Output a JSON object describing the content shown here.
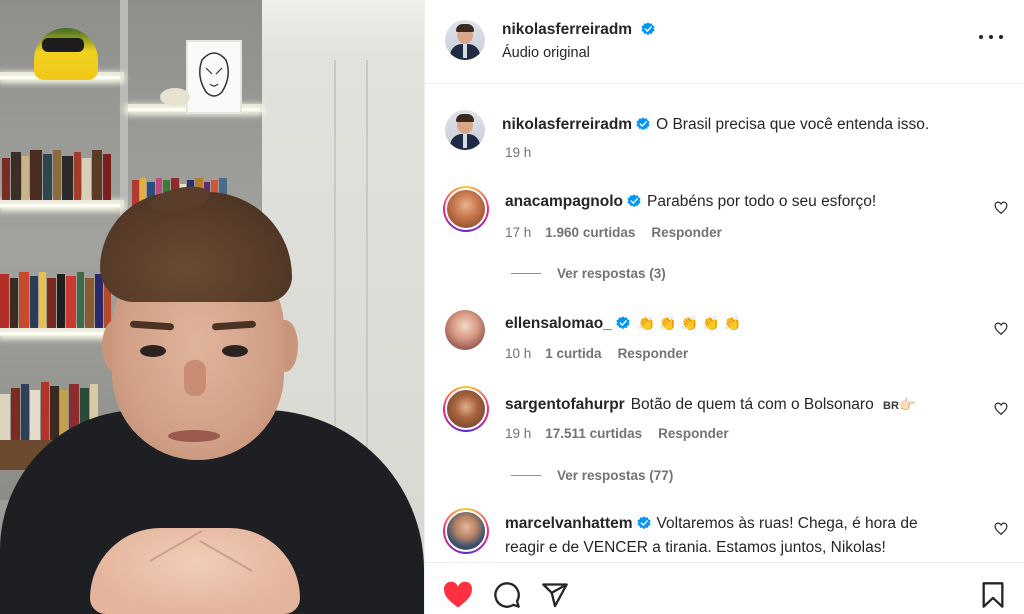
{
  "post": {
    "username": "nikolasferreiradm",
    "audio": "Áudio original",
    "caption": "O Brasil precisa que você entenda isso.",
    "time": "19 h"
  },
  "comments": [
    {
      "username": "anacampagnolo",
      "verified": true,
      "text": "Parabéns por todo o seu esforço!",
      "time": "17 h",
      "likes": "1.960 curtidas",
      "reply": "Responder",
      "view_replies": "Ver respostas (3)"
    },
    {
      "username": "ellensalomao_",
      "verified": true,
      "text": "👏👏👏👏👏",
      "time": "10 h",
      "likes": "1 curtida",
      "reply": "Responder"
    },
    {
      "username": "sargentofahurpr",
      "verified": false,
      "text": "Botão de quem tá com o Bolsonaro",
      "flag": "BR",
      "pointing": "👉🏻",
      "time": "19 h",
      "likes": "17.511 curtidas",
      "reply": "Responder",
      "view_replies": "Ver respostas (77)"
    },
    {
      "username": "marcelvanhattem",
      "verified": true,
      "text_line1": "Voltaremos às ruas! Chega, é hora de",
      "text_line2": "reagir e de VENCER a tirania. Estamos juntos, Nikolas!"
    }
  ],
  "icons": {
    "more": "more-options-icon",
    "like": "heart-icon",
    "comment": "comment-icon",
    "share": "share-icon",
    "save": "bookmark-icon",
    "verified": "verified-badge-icon"
  },
  "colors": {
    "verified": "#0095f6",
    "like_active": "#ff3040",
    "muted_text": "#737373"
  }
}
